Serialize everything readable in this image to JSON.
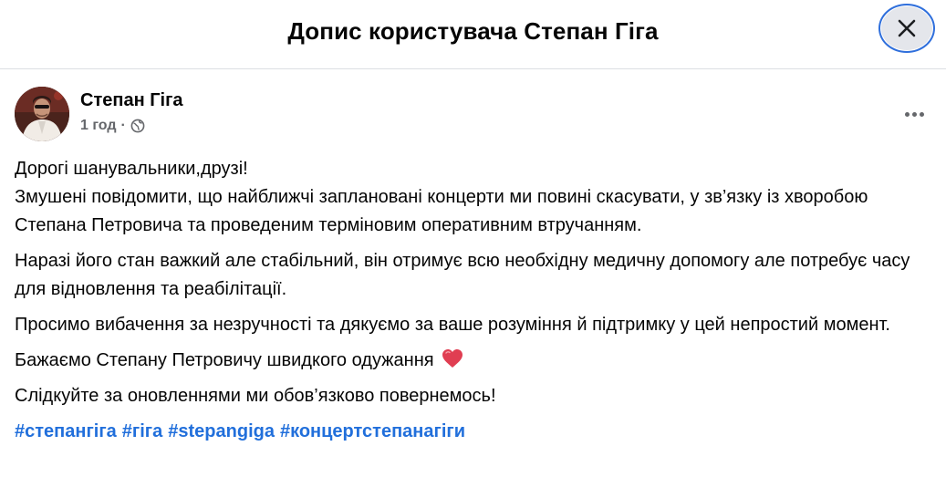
{
  "dialog": {
    "title": "Допис користувача Степан Гіга",
    "close_icon": "close-icon"
  },
  "post": {
    "author": "Степан Гіга",
    "time": "1 год",
    "separator": "·",
    "privacy_icon": "globe-icon",
    "more_icon": "more-horizontal-icon",
    "paragraphs": [
      {
        "line1": "Дорогі шанувальники,друзі!",
        "line2": "Змушені повідомити, що найближчі заплановані концерти ми повині скасувати, у зв’язку із хворобою Степана Петровича та проведеним терміновим оперативним втручанням."
      },
      {
        "text": "Наразі його стан важкий але стабільний, він отримує всю необхідну медичну допомогу але потребує часу для відновлення та реабілітації."
      },
      {
        "text": "Просимо вибачення за незручності та дякуємо за ваше розуміння й підтримку у цей непростий момент."
      },
      {
        "text": "Бажаємо Степану Петровичу швидкого одужання",
        "emoji": "heart-icon"
      },
      {
        "text": "Слідкуйте за оновленнями ми обов’язково повернемось!"
      }
    ],
    "hashtags": [
      "#степангіга",
      "#гіга",
      "#stepangiga",
      "#концертстепанагіги"
    ]
  },
  "colors": {
    "link": "#216fdb",
    "muted": "#65676b",
    "heart": "#e03e52",
    "focus_ring": "#2f6fdc"
  }
}
